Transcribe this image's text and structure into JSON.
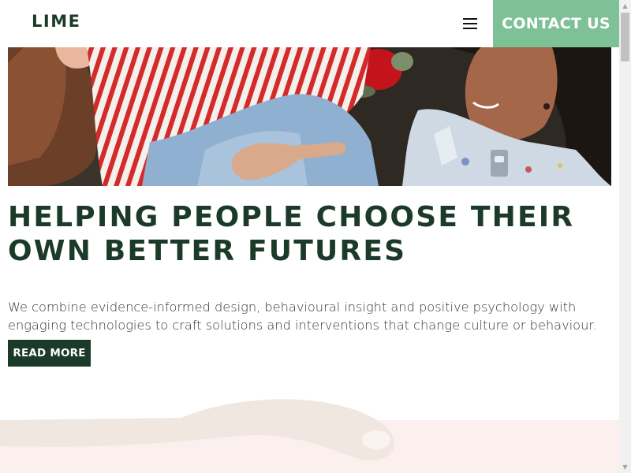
{
  "header": {
    "logo": "LIME",
    "menu_icon": "hamburger-menu-icon",
    "contact_label": "CONTACT US"
  },
  "hero": {
    "alt": "Two women laughing together outdoors"
  },
  "main": {
    "headline": "HELPING PEOPLE CHOOSE THEIR OWN BETTER FUTURES",
    "intro": "We combine evidence-informed design, behavioural insight and positive psychology with engaging technologies to craft solutions and interventions that change culture or behaviour.",
    "read_more_label": "READ MORE"
  },
  "scrollbar": {
    "up_icon": "▲",
    "down_icon": "▼"
  },
  "colors": {
    "brand_dark": "#1b3a29",
    "accent_green": "#7ec196",
    "deco_sand": "#efe7e0",
    "deco_pink": "#fbf0ee"
  }
}
